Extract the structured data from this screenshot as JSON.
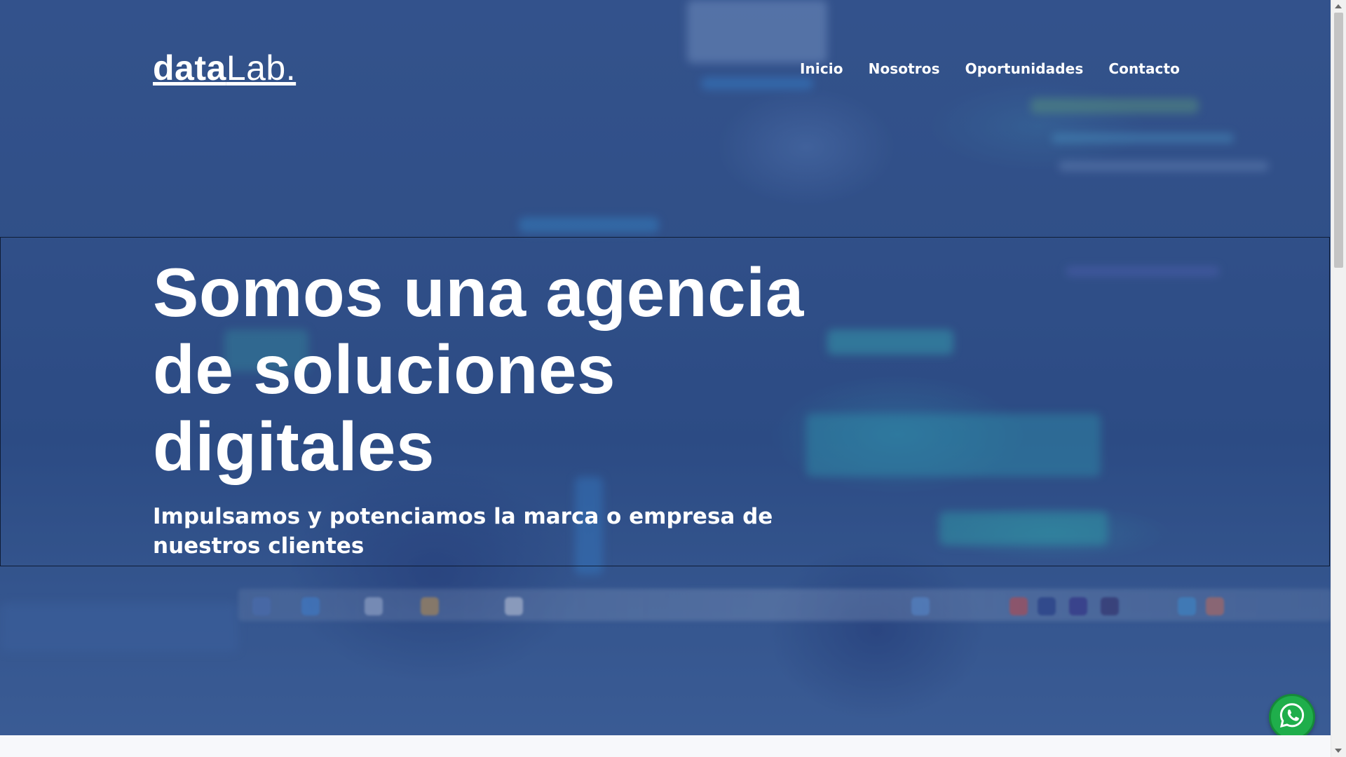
{
  "header": {
    "logo_bold": "data",
    "logo_light": "Lab."
  },
  "nav": {
    "items": [
      {
        "label": "Inicio"
      },
      {
        "label": "Nosotros"
      },
      {
        "label": "Oportunidades"
      },
      {
        "label": "Contacto"
      }
    ]
  },
  "hero": {
    "headline": "Somos una agencia de soluciones digitales",
    "subheadline": "Impulsamos y potenciamos la marca o empresa de nuestros clientes",
    "background_description_icon": "blurred-code-screen-background",
    "overlay_color": "#2b4d8a"
  },
  "floating": {
    "whatsapp_icon": "whatsapp-icon",
    "whatsapp_color": "#1fae4b"
  },
  "scrollbar": {
    "icon_up": "scroll-up-arrow-icon",
    "icon_down": "scroll-down-arrow-icon"
  }
}
